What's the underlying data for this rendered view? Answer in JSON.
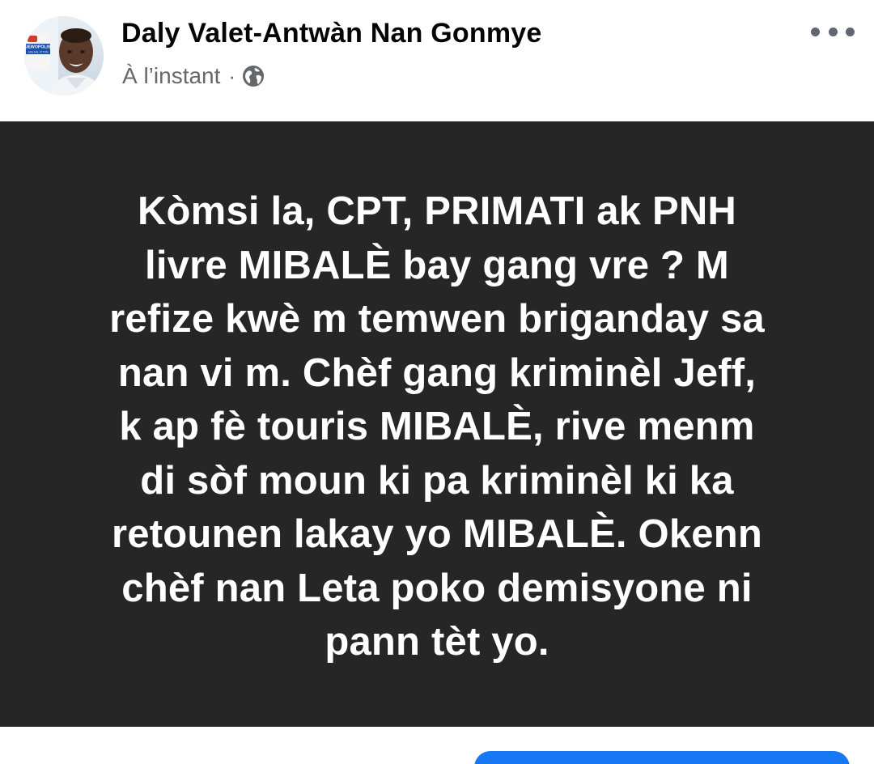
{
  "post": {
    "author": "Daly Valet-Antwàn Nan Gonmye",
    "timestamp": "À l’instant",
    "separator": "·",
    "privacy_icon": "globe-icon",
    "menu_icon": "more-horizontal-icon",
    "avatar_badge_text": "JEWOPOLIS",
    "avatar_badge_subtext": "JAN KAL PITON",
    "text": "Kòmsi la, CPT, PRIMATI ak PNH\nlivre MIBALÈ bay gang vre ? M\nrefize kwè m temwen briganday sa\nnan vi m.  Chèf gang  kriminèl Jeff,\nk ap fè touris MIBALÈ,  rive  menm\ndi sòf moun ki pa kriminèl ki ka\nretounen lakay yo MIBALÈ. Okenn\nchèf nan Leta poko demisyone ni\npann tèt yo."
  },
  "colors": {
    "card_background": "#262626",
    "card_text": "#ffffff",
    "name_text": "#050505",
    "meta_text": "#65676b",
    "button_blue": "#1877f2"
  }
}
